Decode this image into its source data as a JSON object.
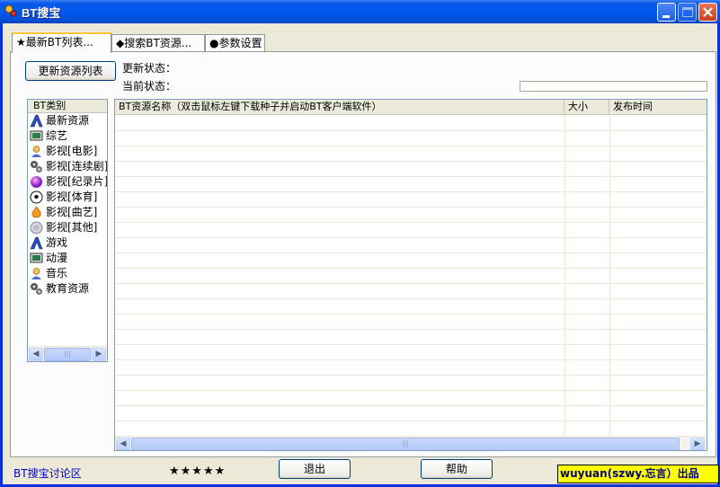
{
  "window": {
    "title": "BT搜宝"
  },
  "tabs": [
    {
      "label": "★最新BT列表..."
    },
    {
      "label": "◆搜索BT资源..."
    },
    {
      "label": "●参数设置"
    }
  ],
  "toolbar": {
    "refresh_label": "更新资源列表",
    "update_status_label": "更新状态：",
    "current_status_label": "当前状态：",
    "progress": 0
  },
  "categories": {
    "header": "BT类别",
    "items": [
      {
        "label": "最新资源",
        "icon": "letter-a-icon"
      },
      {
        "label": "综艺",
        "icon": "tv-icon"
      },
      {
        "label": "影视[电影]",
        "icon": "user-icon"
      },
      {
        "label": "影视[连续剧]",
        "icon": "gears-icon"
      },
      {
        "label": "影视[纪录片]",
        "icon": "globe-icon"
      },
      {
        "label": "影视[体育]",
        "icon": "soccer-ball-icon"
      },
      {
        "label": "影视[曲艺]",
        "icon": "flame-icon"
      },
      {
        "label": "影视[其他]",
        "icon": "disc-icon"
      },
      {
        "label": "游戏",
        "icon": "letter-a-icon"
      },
      {
        "label": "动漫",
        "icon": "tv-icon"
      },
      {
        "label": "音乐",
        "icon": "user-icon"
      },
      {
        "label": "教育资源",
        "icon": "gears-icon"
      }
    ]
  },
  "table": {
    "columns": [
      {
        "label": "BT资源名称（双击鼠标左键下载种子并启动BT客户端软件）"
      },
      {
        "label": "大小"
      },
      {
        "label": "发布时间"
      }
    ],
    "rows": []
  },
  "footer": {
    "forum_link": "BT搜宝讨论区",
    "stars": "★★★★★",
    "exit_label": "退出",
    "help_label": "帮助",
    "credit": "wuyuan(szwy.忘言）出品"
  }
}
